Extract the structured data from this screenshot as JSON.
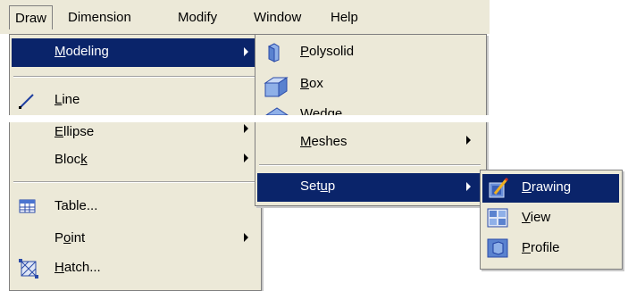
{
  "menubar": {
    "items": [
      {
        "key": "draw",
        "label": "Draw"
      },
      {
        "key": "dimension",
        "label": "Dimension"
      },
      {
        "key": "modify",
        "label": "Modify"
      },
      {
        "key": "window",
        "label": "Window"
      },
      {
        "key": "help",
        "label": "Help"
      }
    ]
  },
  "draw_menu": {
    "modeling": {
      "pre": "",
      "ul": "M",
      "post": "odeling"
    },
    "line": {
      "pre": "",
      "ul": "L",
      "post": "ine"
    },
    "ellipse": {
      "pre": "",
      "ul": "E",
      "post": "llipse"
    },
    "block": {
      "pre": "Bloc",
      "ul": "k",
      "post": ""
    },
    "table": {
      "pre": "",
      "ul": "",
      "post": "Table..."
    },
    "point": {
      "pre": "P",
      "ul": "o",
      "post": "int"
    },
    "hatch": {
      "pre": "",
      "ul": "H",
      "post": "atch..."
    }
  },
  "modeling_menu": {
    "polysolid": {
      "pre": "",
      "ul": "P",
      "post": "olysolid"
    },
    "box": {
      "pre": "",
      "ul": "B",
      "post": "ox"
    },
    "wedge": {
      "pre": "",
      "ul": "W",
      "post": "edge"
    },
    "meshes": {
      "pre": "",
      "ul": "M",
      "post": "eshes"
    },
    "setup": {
      "pre": "Set",
      "ul": "u",
      "post": "p"
    }
  },
  "setup_menu": {
    "drawing": {
      "pre": "",
      "ul": "D",
      "post": "rawing"
    },
    "view": {
      "pre": "",
      "ul": "V",
      "post": "iew"
    },
    "profile": {
      "pre": "",
      "ul": "P",
      "post": "rofile"
    }
  },
  "colors": {
    "menu_bg": "#ece9d8",
    "highlight": "#0a246a",
    "highlight_text": "#ffffff"
  },
  "icons": {
    "line": "line-icon",
    "table": "table-icon",
    "hatch": "hatch-icon",
    "polysolid": "polysolid-icon",
    "box": "box-icon",
    "wedge": "wedge-icon",
    "drawing": "drawing-icon",
    "view": "view-icon",
    "profile": "profile-icon"
  }
}
